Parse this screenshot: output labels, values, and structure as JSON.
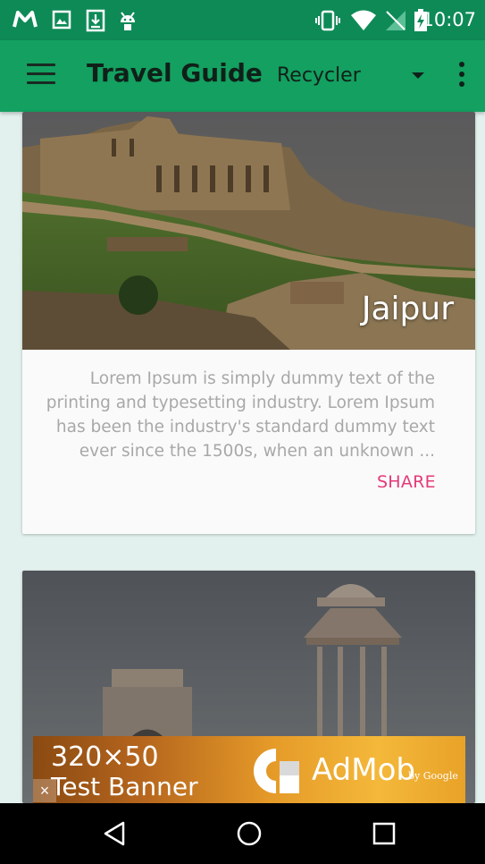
{
  "status_bar": {
    "time": "10:07",
    "left_icons": [
      "gmail-icon",
      "image-icon",
      "download-icon",
      "android-icon"
    ],
    "right_icons": [
      "vibrate-icon",
      "wifi-icon",
      "no-signal-icon",
      "battery-charging-icon"
    ]
  },
  "app_bar": {
    "menu_icon": "hamburger-menu-icon",
    "title": "Travel Guide",
    "spinner_value": "Recycler",
    "overflow_icon": "more-vertical-icon",
    "color": "#13a060"
  },
  "cards": [
    {
      "title": "Jaipur",
      "description": "Lorem Ipsum is simply dummy text of the printing and typesetting industry. Lorem Ipsum has been the industry's standard dummy text ever since the 1500s, when an unknown ...",
      "action": "SHARE"
    },
    {
      "title": "",
      "description": "",
      "action": ""
    }
  ],
  "ad_banner": {
    "line1": "320×50",
    "line2": "Test Banner",
    "brand": "AdMob",
    "by": "by Google",
    "close": "×"
  },
  "nav_bar": {
    "buttons": [
      "back-icon",
      "home-icon",
      "recents-icon"
    ]
  },
  "colors": {
    "accent": "#e53a78",
    "primary": "#13a060",
    "primary_dark": "#0e8a57",
    "background": "#e3f1ee"
  }
}
